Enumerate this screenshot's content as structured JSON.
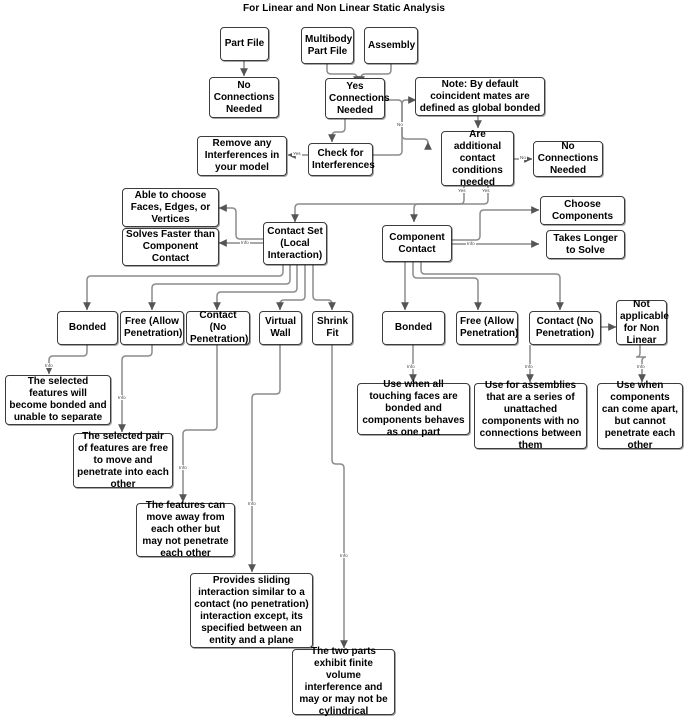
{
  "diagram": {
    "title": "For Linear and Non Linear Static Analysis",
    "stroke_color": "#3c3c3c",
    "wire_color": "#8c8c8c",
    "arrow_color": "#555555",
    "background": "#ffffff"
  },
  "nodes": {
    "part_file": "Part File",
    "multibody_part_file": "Multibody\nPart File",
    "assembly": "Assembly",
    "no_connections_needed_left": "No\nConnections\nNeeded",
    "yes_connections_needed": "Yes\nConnections\nNeeded",
    "note_coincident": "Note: By default coincident mates are defined as global bonded",
    "remove_interferences": "Remove any Interferences in your model",
    "check_interferences": "Check for Interferences",
    "additional_contact": "Are additional contact conditions needed",
    "no_connections_needed_right": "No\nConnections\nNeeded",
    "able_to_choose": "Able to choose Faces, Edges, or Vertices",
    "solves_faster": "Solves Faster than Component Contact",
    "contact_set": "Contact Set (Local Interaction)",
    "component_contact": "Component Contact",
    "choose_components": "Choose Components",
    "takes_longer": "Takes Longer to Solve",
    "left_bonded": "Bonded",
    "left_free": "Free (Allow Penetration)",
    "left_contact": "Contact (No Penetration)",
    "virtual_wall": "Virtual Wall",
    "shrink_fit": "Shrink Fit",
    "right_bonded": "Bonded",
    "right_free": "Free (Allow Penetration)",
    "right_contact": "Contact (No Penetration)",
    "not_applicable": "Not applicable for Non Linear",
    "desc_bonded_left": "The selected features will become bonded and unable to separate",
    "desc_free_left": "The selected pair of features are free to move and penetrate into each other",
    "desc_contact_left": "The features can move away from each other but may not penetrate each other",
    "desc_virtual_wall": "Provides sliding interaction similar to a contact (no penetration) interaction except, its specified between an entity and a plane",
    "desc_shrink_fit": "The two parts exhibit finite volume interference and may or may not be cylindrical",
    "desc_bonded_right": "Use when all touching faces are bonded and components behaves as one part",
    "desc_free_right": "Use for assemblies that are a series of unattached components with no connections between them",
    "desc_contact_right": "Use when components can come apart, but cannot penetrate each other"
  },
  "edge_labels": {
    "no_from_yes": "No",
    "yes_interferences": "Yes",
    "no_additional": "No",
    "yes_left": "Yes",
    "yes_right": "Yes",
    "info_contact_set": "Info",
    "info_component_contact": "Info",
    "info_bonded_left": "Info",
    "info_free_left": "Info",
    "info_contact_left": "Info",
    "info_virtual_wall": "Info",
    "info_shrink_fit": "Info",
    "info_bonded_right": "Info",
    "info_free_right": "Info",
    "info_contact_right": "Info"
  }
}
